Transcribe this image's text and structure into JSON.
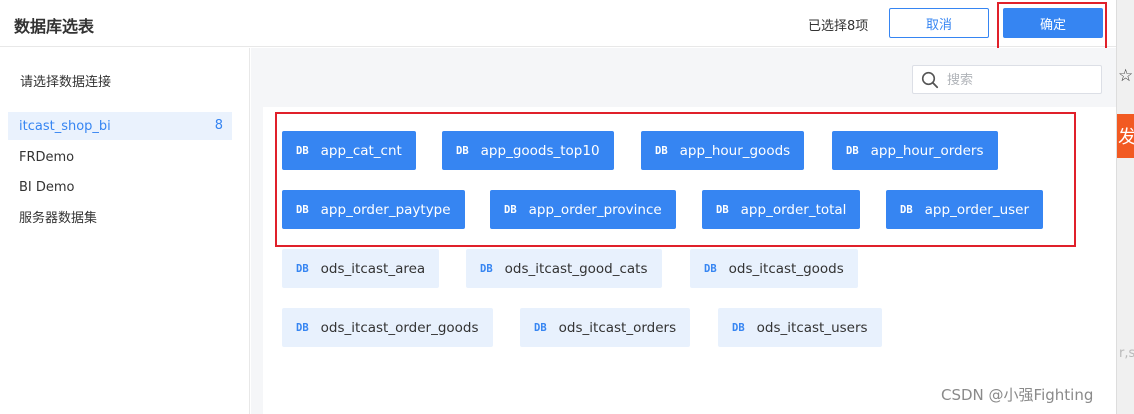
{
  "header": {
    "title": "数据库选表",
    "selected_count": "已选择8项",
    "cancel_label": "取消",
    "confirm_label": "确定"
  },
  "sidebar": {
    "heading": "请选择数据连接",
    "items": [
      {
        "label": "itcast_shop_bi",
        "count": "8",
        "active": true
      },
      {
        "label": "FRDemo"
      },
      {
        "label": "BI Demo"
      },
      {
        "label": "服务器数据集"
      }
    ]
  },
  "search": {
    "placeholder": "搜索",
    "value": ""
  },
  "table_icon_text": "DB",
  "tables": [
    {
      "name": "app_cat_cnt",
      "selected": true
    },
    {
      "name": "app_goods_top10",
      "selected": true
    },
    {
      "name": "app_hour_goods",
      "selected": true
    },
    {
      "name": "app_hour_orders",
      "selected": true
    },
    {
      "name": "app_order_paytype",
      "selected": true
    },
    {
      "name": "app_order_province",
      "selected": true
    },
    {
      "name": "app_order_total",
      "selected": true
    },
    {
      "name": "app_order_user",
      "selected": true
    },
    {
      "name": "ods_itcast_area",
      "selected": false
    },
    {
      "name": "ods_itcast_good_cats",
      "selected": false
    },
    {
      "name": "ods_itcast_goods",
      "selected": false
    },
    {
      "name": "ods_itcast_order_goods",
      "selected": false
    },
    {
      "name": "ods_itcast_orders",
      "selected": false
    },
    {
      "name": "ods_itcast_users",
      "selected": false
    }
  ],
  "edge": {
    "red_tab_char": "发",
    "text": "r,si"
  },
  "watermark": "CSDN @小强Fighting",
  "colors": {
    "accent": "#3685f2",
    "chip_unselected_bg": "#e8f1fd",
    "highlight_red": "#e0202a"
  }
}
